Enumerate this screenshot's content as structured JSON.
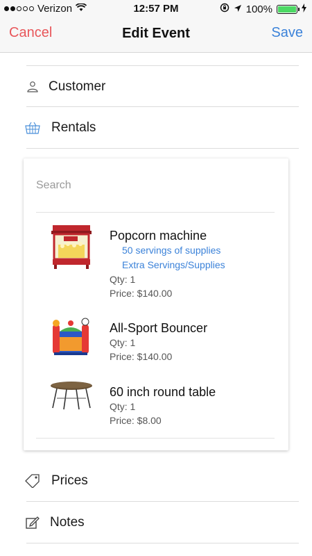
{
  "status": {
    "carrier": "Verizon",
    "time": "12:57 PM",
    "battery": "100%",
    "battery_level": 1.0,
    "signal_bars": 2
  },
  "nav": {
    "cancel": "Cancel",
    "title": "Edit Event",
    "save": "Save"
  },
  "sections": {
    "customer": "Customer",
    "rentals": "Rentals",
    "prices": "Prices",
    "notes": "Notes"
  },
  "rentals": {
    "search_placeholder": "Search",
    "items": [
      {
        "name": "Popcorn machine",
        "addons": [
          "50 servings of supplies",
          "Extra Servings/Supplies"
        ],
        "qty": "Qty: 1",
        "price": "Price: $140.00"
      },
      {
        "name": "All-Sport Bouncer",
        "addons": [],
        "qty": "Qty: 1",
        "price": "Price: $140.00"
      },
      {
        "name": "60 inch round table",
        "addons": [],
        "qty": "Qty: 1",
        "price": "Price: $8.00"
      }
    ]
  },
  "colors": {
    "accent_blue": "#3b82d9",
    "cancel_red": "#e8565a",
    "battery_green": "#4cd964"
  }
}
